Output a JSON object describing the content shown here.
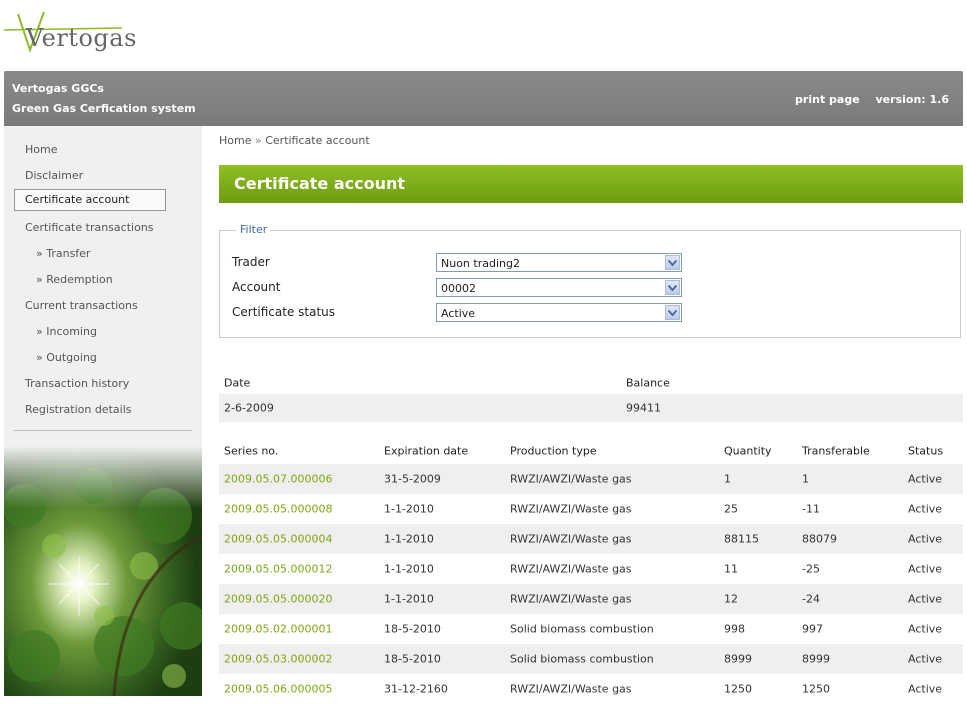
{
  "logo": {
    "text": "Vertogas"
  },
  "header": {
    "title_line1": "Vertogas GGCs",
    "title_line2": "Green Gas Cerfication system",
    "print_label": "print page",
    "version_label": "version: 1.6"
  },
  "sidebar": {
    "items": [
      {
        "label": "Home"
      },
      {
        "label": "Disclaimer"
      },
      {
        "label": "Certificate account"
      },
      {
        "label": "Certificate transactions"
      },
      {
        "label": "» Transfer"
      },
      {
        "label": "» Redemption"
      },
      {
        "label": "Current transactions"
      },
      {
        "label": "» Incoming"
      },
      {
        "label": "» Outgoing"
      },
      {
        "label": "Transaction history"
      },
      {
        "label": "Registration details"
      }
    ]
  },
  "breadcrumb": {
    "home": "Home",
    "sep": "»",
    "current": "Certificate account"
  },
  "page_title": "Certificate account",
  "filter": {
    "legend": "Filter",
    "trader_label": "Trader",
    "trader_value": "Nuon trading2",
    "account_label": "Account",
    "account_value": "00002",
    "status_label": "Certificate status",
    "status_value": "Active"
  },
  "balance": {
    "headers": {
      "date": "Date",
      "balance": "Balance"
    },
    "row": {
      "date": "2-6-2009",
      "balance": "99411"
    }
  },
  "table": {
    "headers": {
      "series": "Series no.",
      "expiration": "Expiration date",
      "production": "Production type",
      "quantity": "Quantity",
      "transferable": "Transferable",
      "status": "Status"
    },
    "rows": [
      {
        "series": "2009.05.07.000006",
        "expiration": "31-5-2009",
        "production": "RWZI/AWZI/Waste gas",
        "quantity": "1",
        "transferable": "1",
        "status": "Active"
      },
      {
        "series": "2009.05.05.000008",
        "expiration": "1-1-2010",
        "production": "RWZI/AWZI/Waste gas",
        "quantity": "25",
        "transferable": "-11",
        "status": "Active"
      },
      {
        "series": "2009.05.05.000004",
        "expiration": "1-1-2010",
        "production": "RWZI/AWZI/Waste gas",
        "quantity": "88115",
        "transferable": "88079",
        "status": "Active"
      },
      {
        "series": "2009.05.05.000012",
        "expiration": "1-1-2010",
        "production": "RWZI/AWZI/Waste gas",
        "quantity": "11",
        "transferable": "-25",
        "status": "Active"
      },
      {
        "series": "2009.05.05.000020",
        "expiration": "1-1-2010",
        "production": "RWZI/AWZI/Waste gas",
        "quantity": "12",
        "transferable": "-24",
        "status": "Active"
      },
      {
        "series": "2009.05.02.000001",
        "expiration": "18-5-2010",
        "production": "Solid biomass combustion",
        "quantity": "998",
        "transferable": "997",
        "status": "Active"
      },
      {
        "series": "2009.05.03.000002",
        "expiration": "18-5-2010",
        "production": "Solid biomass combustion",
        "quantity": "8999",
        "transferable": "8999",
        "status": "Active"
      },
      {
        "series": "2009.05.06.000005",
        "expiration": "31-12-2160",
        "production": "RWZI/AWZI/Waste gas",
        "quantity": "1250",
        "transferable": "1250",
        "status": "Active"
      }
    ]
  },
  "colors": {
    "accent_green": "#7ea615",
    "header_gray": "#808080",
    "banner_green": "#82b31c"
  }
}
